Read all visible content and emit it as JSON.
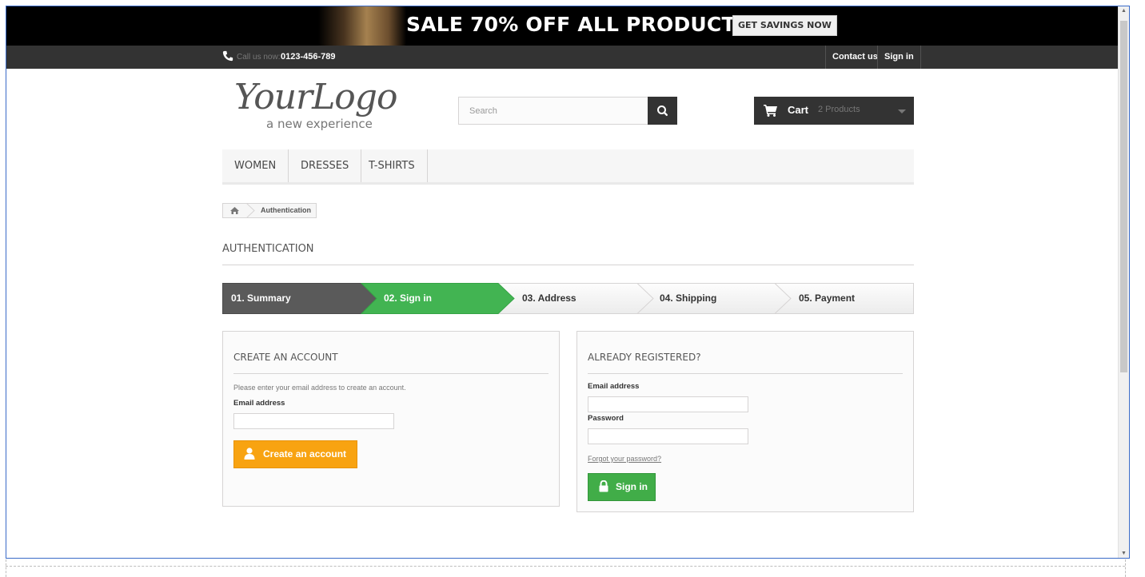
{
  "promo": {
    "headline": "SALE 70% OFF ALL PRODUCTS",
    "button_label": "GET SAVINGS NOW"
  },
  "topbar": {
    "call_label": "Call us now:",
    "phone_number": "0123-456-789",
    "contact_label": "Contact us",
    "signin_label": "Sign in"
  },
  "logo": {
    "main": "YourLogo",
    "tagline": "a new experience"
  },
  "search": {
    "placeholder": "Search"
  },
  "cart": {
    "label": "Cart",
    "count": "2 Products"
  },
  "menu": {
    "items": [
      "WOMEN",
      "DRESSES",
      "T-SHIRTS"
    ]
  },
  "breadcrumb": {
    "current": "Authentication"
  },
  "page": {
    "heading": "AUTHENTICATION"
  },
  "steps": {
    "items": [
      "01. Summary",
      "02. Sign in",
      "03. Address",
      "04. Shipping",
      "05. Payment"
    ],
    "active_index": 1
  },
  "create_account": {
    "title": "CREATE AN ACCOUNT",
    "description": "Please enter your email address to create an account.",
    "email_label": "Email address",
    "button_label": "Create an account"
  },
  "login": {
    "title": "ALREADY REGISTERED?",
    "email_label": "Email address",
    "password_label": "Password",
    "forgot_label": "Forgot your password?",
    "button_label": "Sign in"
  },
  "colors": {
    "step_done": "#5a5a5a",
    "step_active": "#42b452",
    "btn_create": "#f8a311",
    "btn_signin": "#41ad48"
  }
}
